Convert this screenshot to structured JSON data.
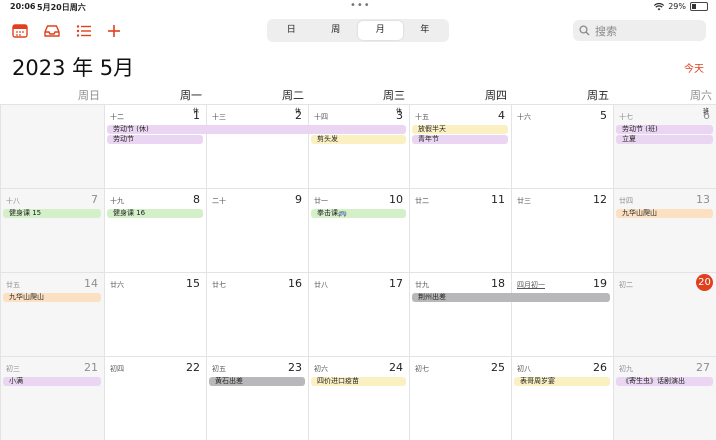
{
  "status": {
    "time": "20:06",
    "date": "5月20日周六",
    "battery": "29%",
    "battery_level": 0.29
  },
  "toolbar": {
    "icons": [
      "calendar-icon",
      "inbox-icon",
      "list-icon",
      "add-icon"
    ],
    "view_tabs": [
      "日",
      "周",
      "月",
      "年"
    ],
    "active_view": "月",
    "search_placeholder": "搜索"
  },
  "header": {
    "title": "2023 年 5月",
    "today_button": "今天"
  },
  "weekdays": [
    "周日",
    "周一",
    "周二",
    "周三",
    "周四",
    "周五",
    "周六"
  ],
  "weeks": [
    {
      "days": [
        {
          "num": "",
          "lunar": ""
        },
        {
          "num": "1",
          "lunar": "十二",
          "badge": "休"
        },
        {
          "num": "2",
          "lunar": "十三",
          "badge": "休"
        },
        {
          "num": "3",
          "lunar": "十四",
          "badge": "休"
        },
        {
          "num": "4",
          "lunar": "十五"
        },
        {
          "num": "5",
          "lunar": "十六"
        },
        {
          "num": "6",
          "lunar": "十七",
          "badge": "班"
        }
      ]
    },
    {
      "days": [
        {
          "num": "7",
          "lunar": "十八"
        },
        {
          "num": "8",
          "lunar": "十九"
        },
        {
          "num": "9",
          "lunar": "二十"
        },
        {
          "num": "10",
          "lunar": "廿一"
        },
        {
          "num": "11",
          "lunar": "廿二"
        },
        {
          "num": "12",
          "lunar": "廿三"
        },
        {
          "num": "13",
          "lunar": "廿四"
        }
      ]
    },
    {
      "days": [
        {
          "num": "14",
          "lunar": "廿五"
        },
        {
          "num": "15",
          "lunar": "廿六"
        },
        {
          "num": "16",
          "lunar": "廿七"
        },
        {
          "num": "17",
          "lunar": "廿八"
        },
        {
          "num": "18",
          "lunar": "廿九"
        },
        {
          "num": "19",
          "lunar": "四月初一"
        },
        {
          "num": "20",
          "lunar": "初二",
          "today": true
        }
      ]
    },
    {
      "days": [
        {
          "num": "21",
          "lunar": "初三"
        },
        {
          "num": "22",
          "lunar": "初四"
        },
        {
          "num": "23",
          "lunar": "初五"
        },
        {
          "num": "24",
          "lunar": "初六"
        },
        {
          "num": "25",
          "lunar": "初七"
        },
        {
          "num": "26",
          "lunar": "初八"
        },
        {
          "num": "27",
          "lunar": "初九"
        }
      ]
    }
  ],
  "events": [
    {
      "title": "劳动节 (休)",
      "week": 0,
      "start": 1,
      "end": 3,
      "row": 0,
      "color": "purple"
    },
    {
      "title": "劳动节",
      "week": 0,
      "start": 1,
      "end": 1,
      "row": 1,
      "color": "purple"
    },
    {
      "title": "剪头发",
      "week": 0,
      "start": 3,
      "end": 3,
      "row": 1,
      "color": "yellow"
    },
    {
      "title": "放假半天",
      "week": 0,
      "start": 4,
      "end": 4,
      "row": 0,
      "color": "yellow"
    },
    {
      "title": "青年节",
      "week": 0,
      "start": 4,
      "end": 4,
      "row": 1,
      "color": "purple"
    },
    {
      "title": "劳动节 (班)",
      "week": 0,
      "start": 6,
      "end": 6,
      "row": 0,
      "color": "purple"
    },
    {
      "title": "立夏",
      "week": 0,
      "start": 6,
      "end": 6,
      "row": 1,
      "color": "purple"
    },
    {
      "title": "健身课 15",
      "week": 1,
      "start": 0,
      "end": 0,
      "row": 0,
      "color": "green"
    },
    {
      "title": "健身课 16",
      "week": 1,
      "start": 1,
      "end": 1,
      "row": 0,
      "color": "green"
    },
    {
      "title": "拳击课",
      "week": 1,
      "start": 3,
      "end": 3,
      "row": 0,
      "color": "green",
      "extra": "🚌"
    },
    {
      "title": "九华山爬山",
      "week": 1,
      "start": 6,
      "end": 6,
      "row": 0,
      "color": "orange"
    },
    {
      "title": "九华山爬山",
      "week": 2,
      "start": 0,
      "end": 0,
      "row": 0,
      "color": "orange"
    },
    {
      "title": "荆州出差",
      "week": 2,
      "start": 4,
      "end": 5,
      "row": 0,
      "color": "gray"
    },
    {
      "title": "小满",
      "week": 3,
      "start": 0,
      "end": 0,
      "row": 0,
      "color": "purple"
    },
    {
      "title": "黄石出差",
      "week": 3,
      "start": 2,
      "end": 2,
      "row": 0,
      "color": "gray"
    },
    {
      "title": "四价进口疫苗",
      "week": 3,
      "start": 3,
      "end": 3,
      "row": 0,
      "color": "yellow"
    },
    {
      "title": "表哥周岁宴",
      "week": 3,
      "start": 5,
      "end": 5,
      "row": 0,
      "color": "yellow"
    },
    {
      "title": "《寄生虫》话剧演出",
      "week": 3,
      "start": 6,
      "end": 6,
      "row": 0,
      "color": "purple"
    }
  ]
}
